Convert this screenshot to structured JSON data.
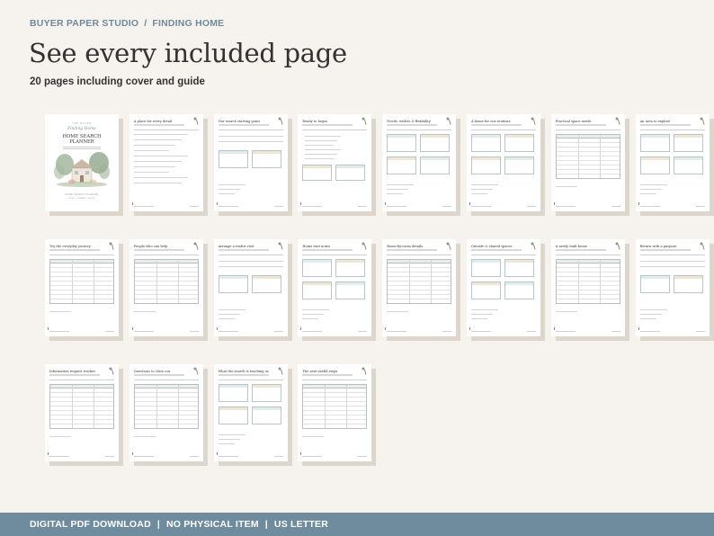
{
  "breadcrumb": {
    "brand": "BUYER PAPER STUDIO",
    "separator": "/",
    "section": "FINDING HOME"
  },
  "heading": {
    "title": "See every included page",
    "subtitle": "20 pages including cover and guide"
  },
  "cover": {
    "top_line": "THE BUYER",
    "script": "Finding Home",
    "title_line1": "HOME SEARCH",
    "title_line2": "PLANNER",
    "bottom_line1": "HOME SEARCH PLANNER",
    "bottom_line2": "PLAN · COMPARE · DECIDE"
  },
  "pages": [
    {
      "title": "A place for every detail",
      "layout": "text"
    },
    {
      "title": "Our search starting point",
      "layout": "boxes2"
    },
    {
      "title": "Ready to begin",
      "layout": "checklist"
    },
    {
      "title": "Needs, wishes & flexibility",
      "layout": "boxes4"
    },
    {
      "title": "A home for our routines",
      "layout": "boxes4"
    },
    {
      "title": "Practical space needs",
      "layout": "table"
    },
    {
      "title": "An area to explore",
      "layout": "boxes4"
    },
    {
      "title": "Try the everyday journey",
      "layout": "table"
    },
    {
      "title": "People who can help",
      "layout": "table"
    },
    {
      "title": "Arrange a realist visit",
      "layout": "boxes2"
    },
    {
      "title": "Home visit notes",
      "layout": "boxes4"
    },
    {
      "title": "Room-by-room details",
      "layout": "table"
    },
    {
      "title": "Outside & shared spaces",
      "layout": "boxes4"
    },
    {
      "title": "A newly built home",
      "layout": "table"
    },
    {
      "title": "Return with a purpose",
      "layout": "boxes2"
    },
    {
      "title": "Information request tracker",
      "layout": "table"
    },
    {
      "title": "Questions to close out",
      "layout": "table"
    },
    {
      "title": "What the search is teaching us",
      "layout": "boxes4"
    },
    {
      "title": "The next useful steps",
      "layout": "table"
    }
  ],
  "footer": {
    "item1": "DIGITAL PDF DOWNLOAD",
    "item2": "NO PHYSICAL ITEM",
    "item3": "US LETTER",
    "separator": "|"
  }
}
